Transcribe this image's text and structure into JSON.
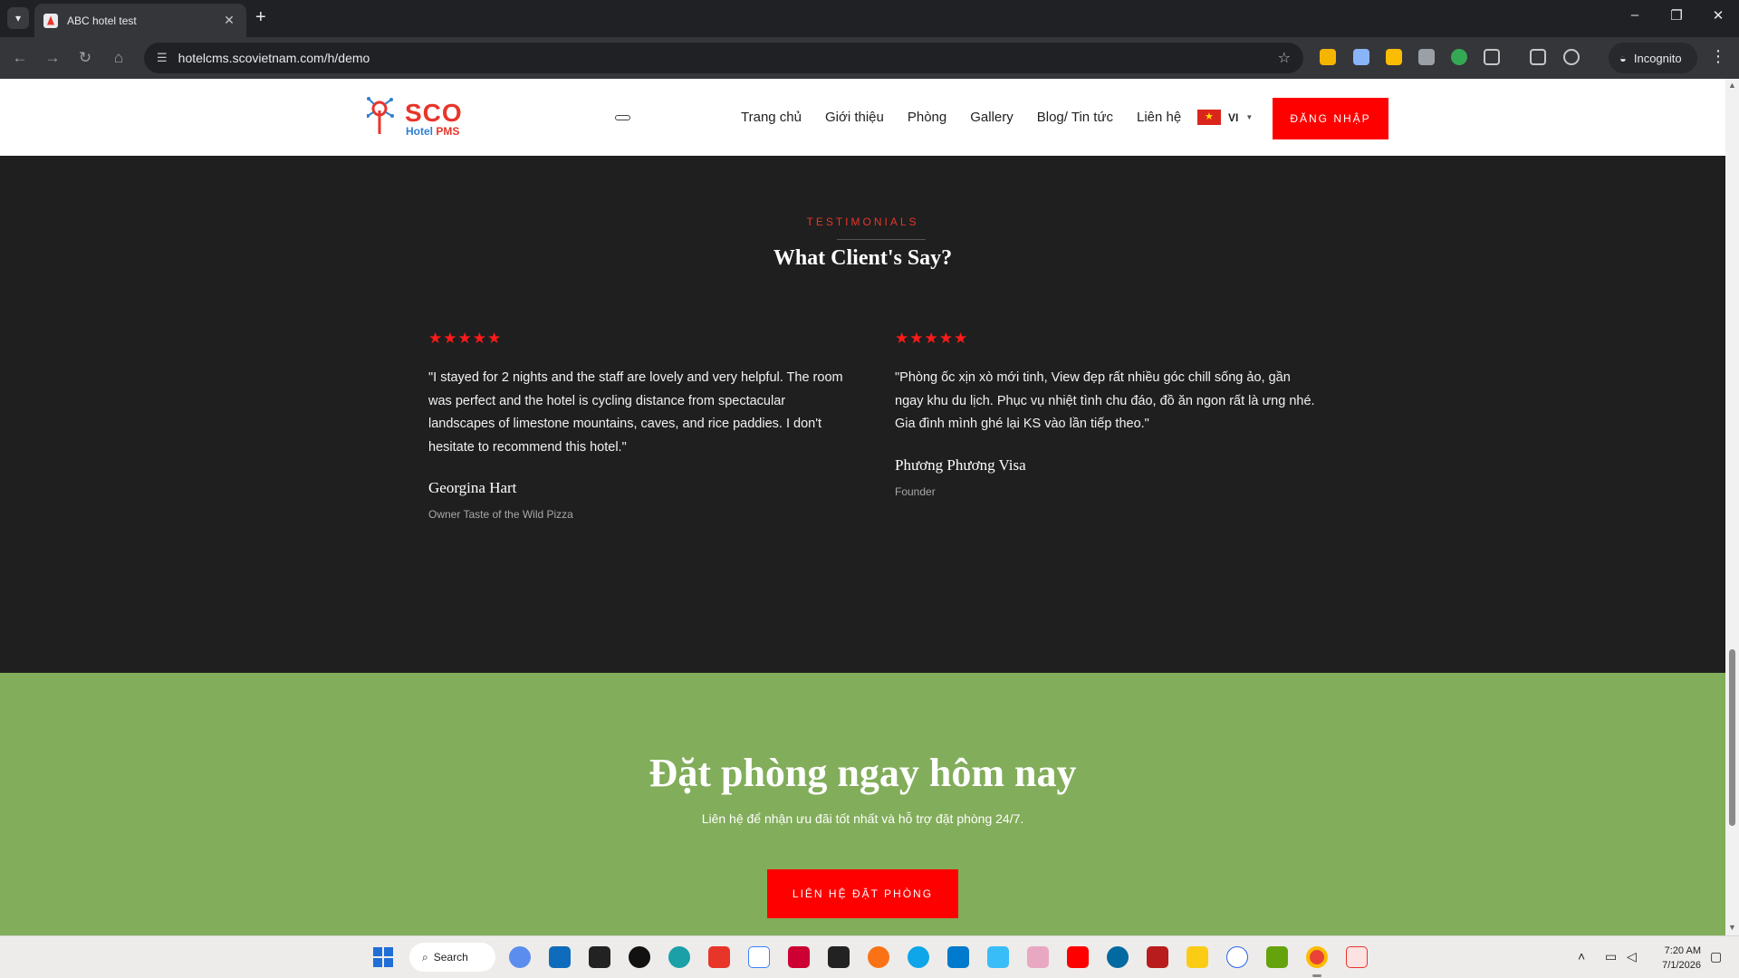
{
  "browser": {
    "tab_title": "ABC hotel test",
    "tab_close": "✕",
    "new_tab": "+",
    "url": "hotelcms.scovietnam.com/h/demo",
    "incognito_label": "Incognito",
    "window_minimize": "–",
    "window_restore": "❐",
    "window_close": "✕"
  },
  "site": {
    "logo": {
      "brand": "SCO",
      "sub1": "Hotel",
      "sub2": "PMS"
    },
    "nav": [
      "Trang chủ",
      "Giới thiệu",
      "Phòng",
      "Gallery",
      "Blog/ Tin tức",
      "Liên hệ"
    ],
    "language": "VI",
    "login_label": "ĐĂNG NHẬP"
  },
  "testimonials": {
    "eyebrow": "TESTIMONIALS",
    "title": "What Client's Say?",
    "items": [
      {
        "rating": 5,
        "quote": "\"I stayed for 2 nights and the staff are lovely and very helpful. The room was perfect and the hotel is cycling distance from spectacular landscapes of limestone mountains, caves, and rice paddies. I don't hesitate to recommend this hotel.\"",
        "author": "Georgina Hart",
        "role": "Owner Taste of the Wild Pizza"
      },
      {
        "rating": 5,
        "quote": "\"Phòng ốc xịn xò mới tinh, View đẹp rất nhiều góc chill sống ảo, gần ngay khu du lịch. Phục vụ nhiệt tình chu đáo, đồ ăn ngon rất là ưng nhé. Gia đình mình ghé lại KS vào lần tiếp theo.\"",
        "author": "Phương Phương Visa",
        "role": "Founder"
      }
    ]
  },
  "cta": {
    "title": "Đặt phòng ngay hôm nay",
    "subtitle": "Liên hệ để nhận ưu đãi tốt nhất và hỗ trợ đặt phòng 24/7.",
    "button": "LIÊN HỆ ĐẶT PHÒNG"
  },
  "taskbar": {
    "search_label": "Search",
    "time": "7:20 AM",
    "date": "7/1/2026"
  },
  "colors": {
    "accent_red": "#ff0000",
    "dark_bg": "#1f1f1f",
    "cta_green": "#82ad5a",
    "brand_blue": "#2f7fd0"
  }
}
